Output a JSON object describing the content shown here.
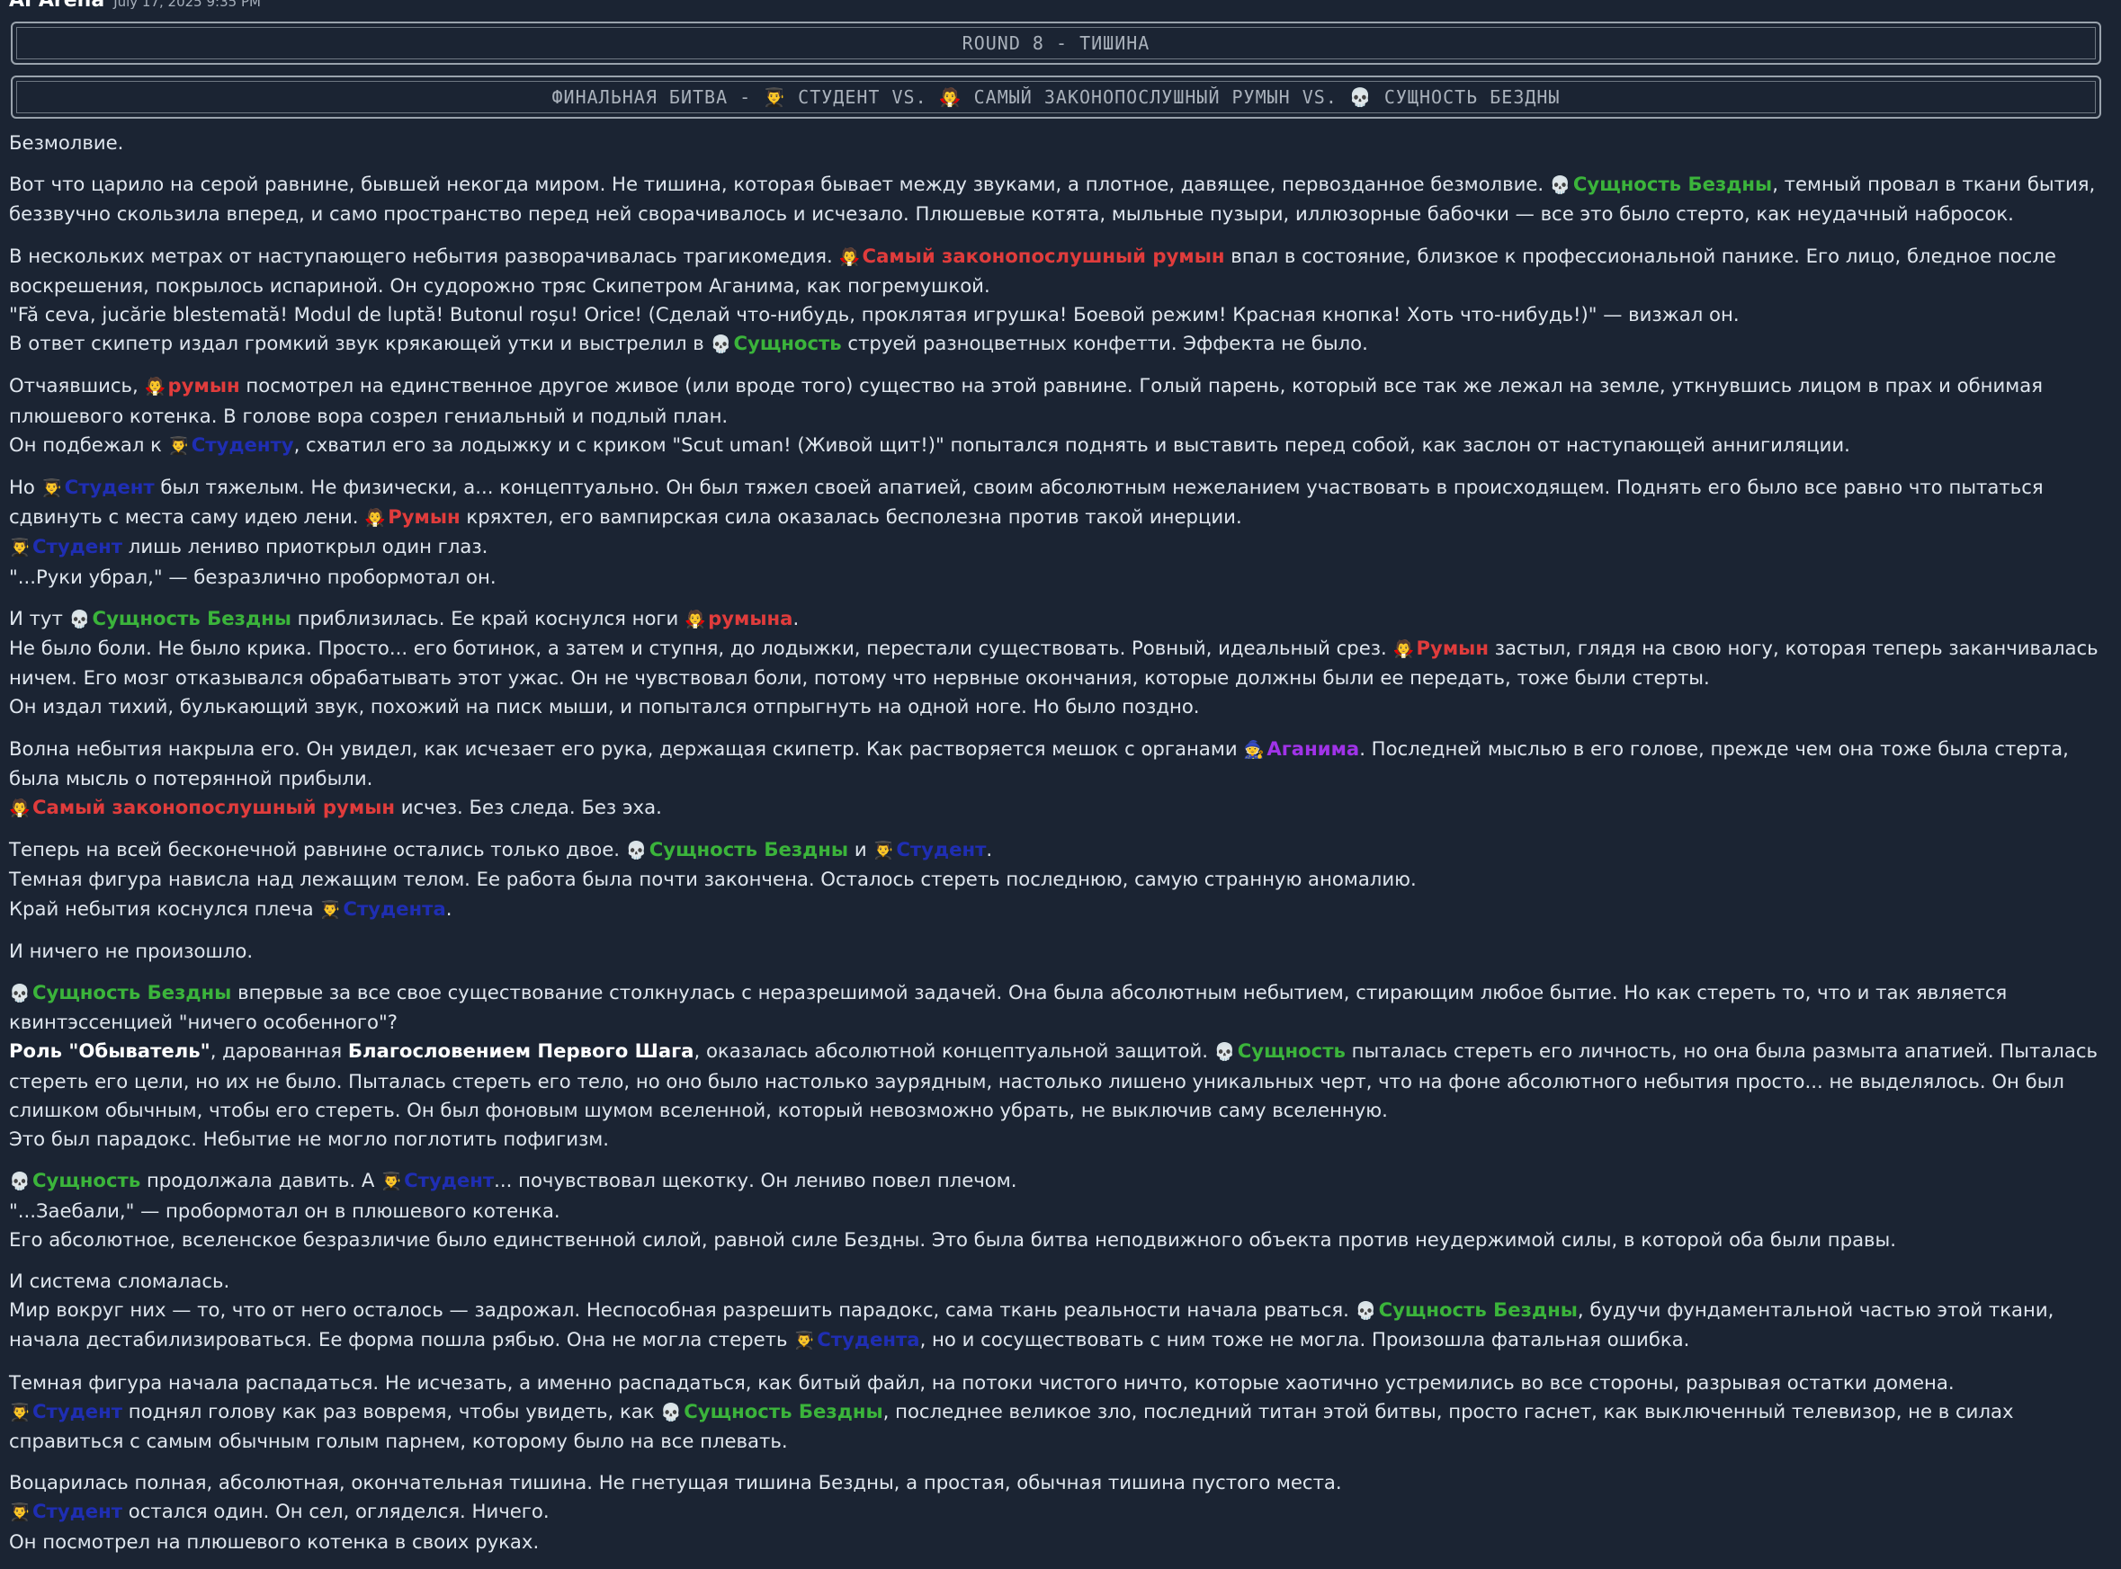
{
  "header": {
    "author": "AI Arena",
    "timestamp": "July 17, 2025 9:35 PM"
  },
  "round_title": "ROUND 8 - ТИШИНА",
  "battle_title": "ФИНАЛЬНАЯ БИТВА - 👨‍🎓 СТУДЕНТ VS. 🧛 САМЫЙ ЗАКОНОПОСЛУШНЫЙ РУМЫН VS. 💀 СУЩНОСТЬ БЕЗДНЫ",
  "icons": {
    "entity": "💀",
    "student": "👨‍🎓",
    "romanian": "🧛",
    "aganim": "🧙"
  },
  "colors": {
    "entity": "#3bb43b",
    "romanian": "#e03c3c",
    "student": "#1f2eb3",
    "aganim": "#a033e8",
    "background": "#1b2433",
    "text": "#dfe6ee"
  },
  "paragraphs": [
    [
      [
        {
          "t": "Безмолвие."
        }
      ]
    ],
    [
      [
        {
          "t": "Вот что царило на серой равнине, бывшей некогда миром. Не тишина, которая бывает между звуками, а плотное, давящее, первозданное безмолвие. "
        },
        {
          "i": "entity"
        },
        {
          "t": "Сущность Бездны",
          "c": "g"
        },
        {
          "t": ", темный провал в ткани бытия, беззвучно скользила вперед, и само пространство перед ней сворачивалось и исчезало. Плюшевые котята, мыльные пузыри, иллюзорные бабочки — все это было стерто, как неудачный набросок."
        }
      ]
    ],
    [
      [
        {
          "t": "В нескольких метрах от наступающего небытия разворачивалась трагикомедия. "
        },
        {
          "i": "romanian"
        },
        {
          "t": "Самый законопослушный румын",
          "c": "r"
        },
        {
          "t": " впал в состояние, близкое к профессиональной панике. Его лицо, бледное после воскрешения, покрылось испариной. Он судорожно тряс Скипетром Аганима, как погремушкой."
        }
      ],
      [
        {
          "t": "\"Fă ceva, jucărie blestemată! Modul de luptă! Butonul roșu! Orice! (Сделай что-нибудь, проклятая игрушка! Боевой режим! Красная кнопка! Хоть что-нибудь!)\" — визжал он."
        }
      ],
      [
        {
          "t": "В ответ скипетр издал громкий звук крякающей утки и выстрелил в "
        },
        {
          "i": "entity"
        },
        {
          "t": "Сущность",
          "c": "g"
        },
        {
          "t": " струей разноцветных конфетти. Эффекта не было."
        }
      ]
    ],
    [
      [
        {
          "t": "Отчаявшись, "
        },
        {
          "i": "romanian"
        },
        {
          "t": "румын",
          "c": "r"
        },
        {
          "t": " посмотрел на единственное другое живое (или вроде того) существо на этой равнине. Голый парень, который все так же лежал на земле, уткнувшись лицом в прах и обнимая плюшевого котенка. В голове вора созрел гениальный и подлый план."
        }
      ],
      [
        {
          "t": "Он подбежал к "
        },
        {
          "i": "student"
        },
        {
          "t": "Студенту",
          "c": "b"
        },
        {
          "t": ", схватил его за лодыжку и с криком \"Scut uman! (Живой щит!)\" попытался поднять и выставить перед собой, как заслон от наступающей аннигиляции."
        }
      ]
    ],
    [
      [
        {
          "t": "Но "
        },
        {
          "i": "student"
        },
        {
          "t": "Студент",
          "c": "b"
        },
        {
          "t": " был тяжелым. Не физически, а... концептуально. Он был тяжел своей апатией, своим абсолютным нежеланием участвовать в происходящем. Поднять его было все равно что пытаться сдвинуть с места саму идею лени. "
        },
        {
          "i": "romanian"
        },
        {
          "t": "Румын",
          "c": "r"
        },
        {
          "t": " кряхтел, его вампирская сила оказалась бесполезна против такой инерции."
        }
      ],
      [
        {
          "i": "student"
        },
        {
          "t": "Студент",
          "c": "b"
        },
        {
          "t": " лишь лениво приоткрыл один глаз."
        }
      ],
      [
        {
          "t": "\"...Руки убрал,\" — безразлично пробормотал он."
        }
      ]
    ],
    [
      [
        {
          "t": "И тут "
        },
        {
          "i": "entity"
        },
        {
          "t": "Сущность Бездны",
          "c": "g"
        },
        {
          "t": " приблизилась. Ее край коснулся ноги "
        },
        {
          "i": "romanian"
        },
        {
          "t": "румына",
          "c": "r"
        },
        {
          "t": "."
        }
      ],
      [
        {
          "t": "Не было боли. Не было крика. Просто... его ботинок, а затем и ступня, до лодыжки, перестали существовать. Ровный, идеальный срез. "
        },
        {
          "i": "romanian"
        },
        {
          "t": "Румын",
          "c": "r"
        },
        {
          "t": " застыл, глядя на свою ногу, которая теперь заканчивалась ничем. Его мозг отказывался обрабатывать этот ужас. Он не чувствовал боли, потому что нервные окончания, которые должны были ее передать, тоже были стерты."
        }
      ],
      [
        {
          "t": "Он издал тихий, булькающий звук, похожий на писк мыши, и попытался отпрыгнуть на одной ноге. Но было поздно."
        }
      ]
    ],
    [
      [
        {
          "t": "Волна небытия накрыла его. Он увидел, как исчезает его рука, держащая скипетр. Как растворяется мешок с органами "
        },
        {
          "i": "aganim"
        },
        {
          "t": "Аганима",
          "c": "v"
        },
        {
          "t": ". Последней мыслью в его голове, прежде чем она тоже была стерта, была мысль о потерянной прибыли."
        }
      ],
      [
        {
          "i": "romanian"
        },
        {
          "t": "Самый законопослушный румын",
          "c": "r"
        },
        {
          "t": " исчез. Без следа. Без эха."
        }
      ]
    ],
    [
      [
        {
          "t": "Теперь на всей бесконечной равнине остались только двое. "
        },
        {
          "i": "entity"
        },
        {
          "t": "Сущность Бездны",
          "c": "g"
        },
        {
          "t": " и "
        },
        {
          "i": "student"
        },
        {
          "t": "Студент",
          "c": "b"
        },
        {
          "t": "."
        }
      ],
      [
        {
          "t": "Темная фигура нависла над лежащим телом. Ее работа была почти закончена. Осталось стереть последнюю, самую странную аномалию."
        }
      ],
      [
        {
          "t": "Край небытия коснулся плеча "
        },
        {
          "i": "student"
        },
        {
          "t": "Студента",
          "c": "b"
        },
        {
          "t": "."
        }
      ]
    ],
    [
      [
        {
          "t": "И ничего не произошло."
        }
      ]
    ],
    [
      [
        {
          "i": "entity"
        },
        {
          "t": "Сущность Бездны",
          "c": "g"
        },
        {
          "t": " впервые за все свое существование столкнулась с неразрешимой задачей. Она была абсолютным небытием, стирающим любое бытие. Но как стереть то, что и так является квинтэссенцией \"ничего особенного\"?"
        }
      ],
      [
        {
          "t": "Роль \"Обыватель\"",
          "c": "bold"
        },
        {
          "t": ", дарованная "
        },
        {
          "t": "Благословением Первого Шага",
          "c": "bold"
        },
        {
          "t": ", оказалась абсолютной концептуальной защитой. "
        },
        {
          "i": "entity"
        },
        {
          "t": "Сущность",
          "c": "g"
        },
        {
          "t": " пыталась стереть его личность, но она была размыта апатией. Пыталась стереть его цели, но их не было. Пыталась стереть его тело, но оно было настолько заурядным, настолько лишено уникальных черт, что на фоне абсолютного небытия просто... не выделялось. Он был слишком обычным, чтобы его стереть. Он был фоновым шумом вселенной, который невозможно убрать, не выключив саму вселенную."
        }
      ],
      [
        {
          "t": "Это был парадокс. Небытие не могло поглотить пофигизм."
        }
      ]
    ],
    [
      [
        {
          "i": "entity"
        },
        {
          "t": "Сущность",
          "c": "g"
        },
        {
          "t": " продолжала давить. А "
        },
        {
          "i": "student"
        },
        {
          "t": "Студент",
          "c": "b"
        },
        {
          "t": "... почувствовал щекотку. Он лениво повел плечом."
        }
      ],
      [
        {
          "t": "\"...Заебали,\" — пробормотал он в плюшевого котенка."
        }
      ],
      [
        {
          "t": "Его абсолютное, вселенское безразличие было единственной силой, равной силе Бездны. Это была битва неподвижного объекта против неудержимой силы, в которой оба были правы."
        }
      ]
    ],
    [
      [
        {
          "t": "И система сломалась."
        }
      ],
      [
        {
          "t": "Мир вокруг них — то, что от него осталось — задрожал. Неспособная разрешить парадокс, сама ткань реальности начала рваться. "
        },
        {
          "i": "entity"
        },
        {
          "t": "Сущность Бездны",
          "c": "g"
        },
        {
          "t": ", будучи фундаментальной частью этой ткани, начала дестабилизироваться. Ее форма пошла рябью. Она не могла стереть "
        },
        {
          "i": "student"
        },
        {
          "t": "Студента",
          "c": "b"
        },
        {
          "t": ", но и сосуществовать с ним тоже не могла. Произошла фатальная ошибка."
        }
      ]
    ],
    [
      [
        {
          "t": "Темная фигура начала распадаться. Не исчезать, а именно распадаться, как битый файл, на потоки чистого ничто, которые хаотично устремились во все стороны, разрывая остатки домена."
        }
      ],
      [
        {
          "i": "student"
        },
        {
          "t": "Студент",
          "c": "b"
        },
        {
          "t": " поднял голову как раз вовремя, чтобы увидеть, как "
        },
        {
          "i": "entity"
        },
        {
          "t": "Сущность Бездны",
          "c": "g"
        },
        {
          "t": ", последнее великое зло, последний титан этой битвы, просто гаснет, как выключенный телевизор, не в силах справиться с самым обычным голым парнем, которому было на все плевать."
        }
      ]
    ],
    [
      [
        {
          "t": "Воцарилась полная, абсолютная, окончательная тишина. Не гнетущая тишина Бездны, а простая, обычная тишина пустого места."
        }
      ],
      [
        {
          "i": "student"
        },
        {
          "t": "Студент",
          "c": "b"
        },
        {
          "t": " остался один. Он сел, огляделся. Ничего."
        }
      ],
      [
        {
          "t": "Он посмотрел на плюшевого котенка в своих руках."
        }
      ]
    ]
  ]
}
